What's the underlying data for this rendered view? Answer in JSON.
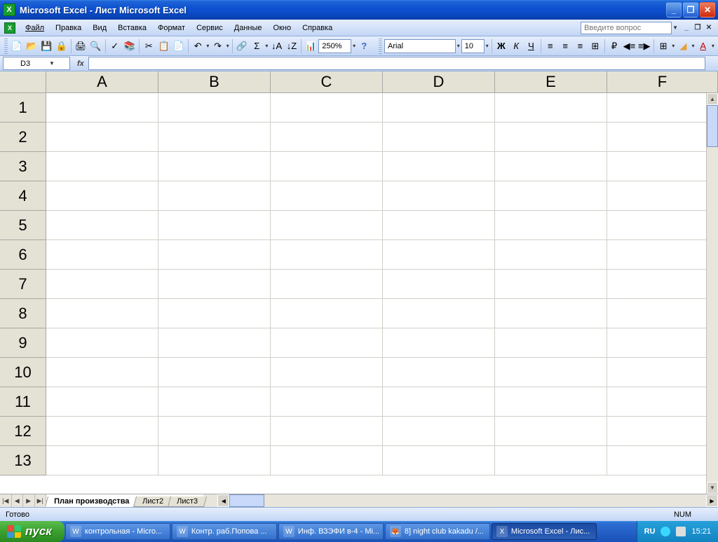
{
  "title": "Microsoft Excel - Лист Microsoft Excel",
  "menu": {
    "items": [
      "Файл",
      "Правка",
      "Вид",
      "Вставка",
      "Формат",
      "Сервис",
      "Данные",
      "Окно",
      "Справка"
    ],
    "question_placeholder": "Введите вопрос"
  },
  "toolbar": {
    "zoom": "250%",
    "font_name": "Arial",
    "font_size": "10"
  },
  "formula_bar": {
    "cell_ref": "D3",
    "fx_label": "fx",
    "formula": ""
  },
  "grid": {
    "columns": [
      "A",
      "B",
      "C",
      "D",
      "E",
      "F"
    ],
    "rows": [
      "1",
      "2",
      "3",
      "4",
      "5",
      "6",
      "7",
      "8",
      "9",
      "10",
      "11",
      "12",
      "13"
    ]
  },
  "sheets": {
    "tabs": [
      "План производства",
      "Лист2",
      "Лист3"
    ],
    "active_index": 0
  },
  "status": {
    "ready": "Готово",
    "num": "NUM"
  },
  "taskbar": {
    "start": "пуск",
    "items": [
      {
        "label": "контрольная - Micro...",
        "icon": "W"
      },
      {
        "label": "Контр. раб.Попова ...",
        "icon": "W"
      },
      {
        "label": "Инф. ВЗЭФИ в-4 - Mi...",
        "icon": "W"
      },
      {
        "label": "8] night club kakadu /...",
        "icon": "🦊"
      },
      {
        "label": "Microsoft Excel - Лис...",
        "icon": "X",
        "active": true
      }
    ],
    "lang": "RU",
    "clock": "15:21"
  }
}
